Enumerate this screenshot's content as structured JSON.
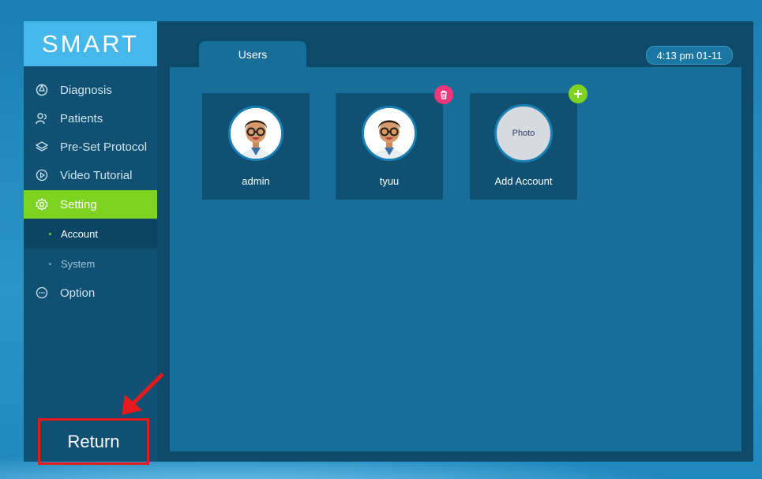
{
  "app": {
    "logo": "SMART"
  },
  "sidebar": {
    "items": [
      {
        "label": "Diagnosis",
        "icon": "diagnosis-icon"
      },
      {
        "label": "Patients",
        "icon": "patients-icon"
      },
      {
        "label": "Pre-Set Protocol",
        "icon": "layers-icon"
      },
      {
        "label": "Video Tutorial",
        "icon": "play-icon"
      },
      {
        "label": "Setting",
        "icon": "gear-icon",
        "active": true
      },
      {
        "label": "Option",
        "icon": "more-icon"
      }
    ],
    "subitems": [
      {
        "label": "Account",
        "active": true
      },
      {
        "label": "System",
        "active": false
      }
    ],
    "return_label": "Return"
  },
  "header": {
    "tab": "Users",
    "clock": "4:13 pm 01-11"
  },
  "users": {
    "cards": [
      {
        "name": "admin",
        "type": "avatar"
      },
      {
        "name": "tyuu",
        "type": "avatar",
        "action": "delete-icon"
      },
      {
        "name": "Add Account",
        "type": "photo",
        "photo_label": "Photo",
        "action": "add-icon"
      }
    ]
  },
  "colors": {
    "accent_green": "#7ed321",
    "delete_pink": "#f0367a",
    "highlight_red": "#e8191b",
    "logo_blue": "#45b7ea"
  }
}
